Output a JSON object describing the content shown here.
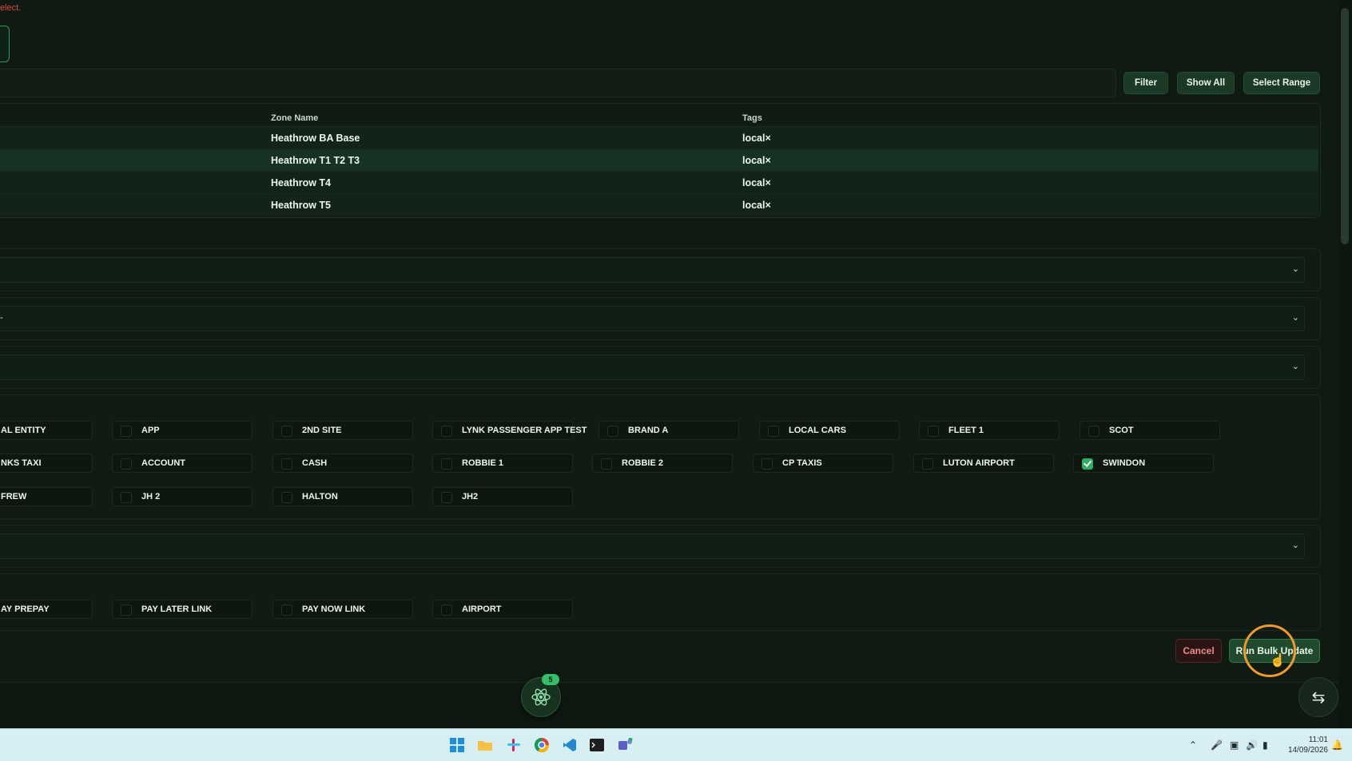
{
  "error_text": "elect.",
  "toolbar": {
    "filter_label": "Filter",
    "show_all_label": "Show All",
    "select_range_label": "Select Range"
  },
  "table": {
    "columns": [
      "Zone Name",
      "Tags"
    ],
    "rows": [
      {
        "zone": "Heathrow BA Base",
        "tag": "local×"
      },
      {
        "zone": "Heathrow T1 T2 T3",
        "tag": "local×"
      },
      {
        "zone": "Heathrow T4",
        "tag": "local×"
      },
      {
        "zone": "Heathrow T5",
        "tag": "local×"
      }
    ]
  },
  "dropdowns": [
    {
      "value": ""
    },
    {
      "value": "-"
    },
    {
      "value": ""
    },
    {
      "value": ""
    }
  ],
  "entities": {
    "row1": [
      "AL ENTITY",
      "APP",
      "2ND SITE",
      "LYNK PASSENGER APP TEST",
      "BRAND A",
      "LOCAL CARS",
      "FLEET 1",
      "SCOT"
    ],
    "row2": [
      "NKS TAXI",
      "ACCOUNT",
      "CASH",
      "ROBBIE 1",
      "ROBBIE 2",
      "CP TAXIS",
      "LUTON AIRPORT",
      "SWINDON"
    ],
    "row3": [
      "FREW",
      "JH 2",
      "HALTON",
      "JH2"
    ]
  },
  "payment": [
    "AY PREPAY",
    "PAY LATER LINK",
    "PAY NOW LINK",
    "AIRPORT"
  ],
  "actions": {
    "cancel_label": "Cancel",
    "run_label": "Run Bulk Update"
  },
  "fab_badge": "5",
  "clock": {
    "time": "11:01",
    "date": "14/09/2026"
  },
  "colors": {
    "accent": "#2fae62",
    "background": "#0f1a12",
    "danger": "#e04848",
    "highlight": "#f2992a"
  }
}
